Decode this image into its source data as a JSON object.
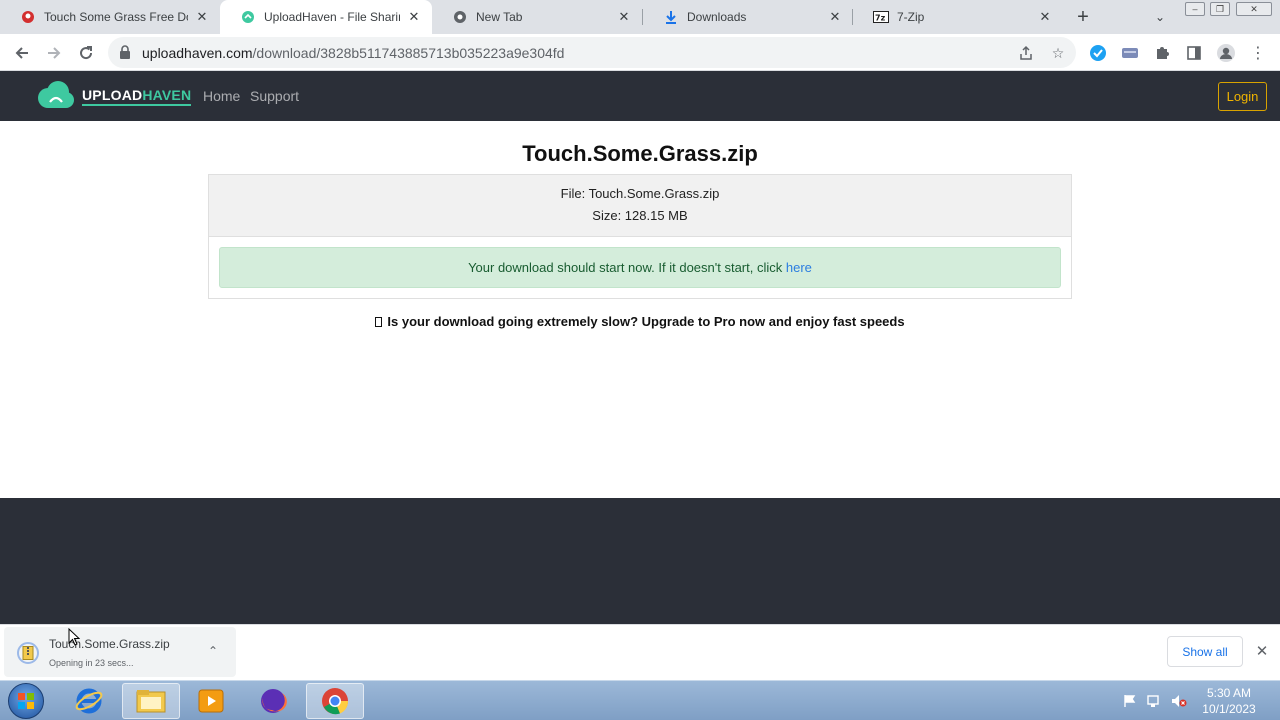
{
  "browser": {
    "tabs": [
      {
        "title": "Touch Some Grass Free Dow",
        "icon": "red-favicon",
        "active": false
      },
      {
        "title": "UploadHaven - File Sharing",
        "icon": "uploadhaven-favicon",
        "active": true
      },
      {
        "title": "New Tab",
        "icon": "chrome-favicon",
        "active": false
      },
      {
        "title": "Downloads",
        "icon": "download-favicon",
        "active": false
      },
      {
        "title": "7-Zip",
        "icon": "7zip-favicon",
        "active": false
      }
    ],
    "url_domain": "uploadhaven.com",
    "url_path": "/download/3828b511743885713b035223a9e304fd"
  },
  "site": {
    "logo_upload": "UPLOAD",
    "logo_haven": "HAVEN",
    "nav": [
      {
        "label": "Home"
      },
      {
        "label": "Support"
      }
    ],
    "login_label": "Login",
    "brand_color": "#3ec9a0"
  },
  "main": {
    "file_title": "Touch.Some.Grass.zip",
    "file_line": "File: Touch.Some.Grass.zip",
    "size_line": "Size: 128.15 MB",
    "alert_text": "Your download should start now. If it doesn't start, click ",
    "alert_link": "here",
    "promo_text": "Is your download going extremely slow? Upgrade to Pro now and enjoy fast speeds"
  },
  "download_shelf": {
    "file_name": "Touch.Some.Grass.zip",
    "status": "Opening in 23 secs...",
    "show_all_label": "Show all"
  },
  "taskbar": {
    "time": "5:30 AM",
    "date": "10/1/2023"
  }
}
